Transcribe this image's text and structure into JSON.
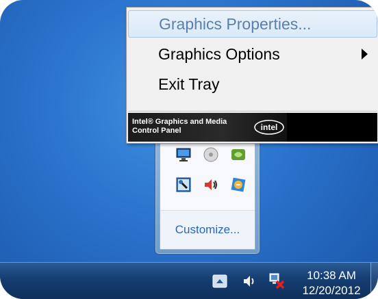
{
  "context_menu": {
    "items": [
      {
        "label": "Graphics Properties...",
        "highlighted": true,
        "has_submenu": false
      },
      {
        "label": "Graphics Options",
        "highlighted": false,
        "has_submenu": true
      },
      {
        "label": "Exit Tray",
        "highlighted": false,
        "has_submenu": false
      }
    ],
    "banner": {
      "text": "Intel® Graphics and Media\nControl Panel",
      "logo_text": "intel"
    }
  },
  "tray_flyout": {
    "icons": [
      "display-monitor-icon",
      "disk-icon",
      "nvidia-icon",
      "network-tool-icon",
      "speaker-volume-icon",
      "globe-update-icon"
    ],
    "customize_label": "Customize..."
  },
  "taskbar": {
    "time": "10:38 AM",
    "date": "12/20/2012",
    "icons": [
      "show-hidden-icons-button",
      "volume-icon",
      "network-error-icon"
    ]
  },
  "colors": {
    "desktop": "#2a72cc",
    "taskbar": "#163f73",
    "menu_highlight_text": "#5b7fa8",
    "link": "#2a66b8",
    "network_error": "#e02020"
  }
}
